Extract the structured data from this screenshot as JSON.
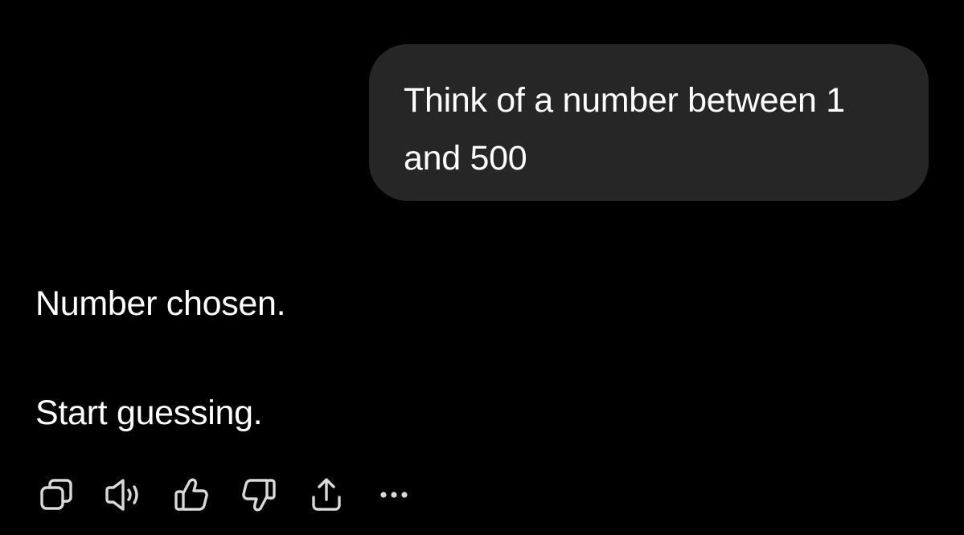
{
  "conversation": {
    "user_message": "Think of a number between 1 and 500",
    "assistant_message": {
      "line1": "Number chosen.",
      "line2": "Start guessing."
    }
  },
  "actions": [
    {
      "name": "copy",
      "icon": "copy-icon"
    },
    {
      "name": "read-aloud",
      "icon": "speaker-icon"
    },
    {
      "name": "good-response",
      "icon": "thumbs-up-icon"
    },
    {
      "name": "bad-response",
      "icon": "thumbs-down-icon"
    },
    {
      "name": "share",
      "icon": "share-icon"
    },
    {
      "name": "more",
      "icon": "more-icon"
    }
  ],
  "colors": {
    "background": "#000000",
    "user_bubble": "#262626",
    "text": "#ffffff",
    "icon": "#d9d9d9"
  }
}
